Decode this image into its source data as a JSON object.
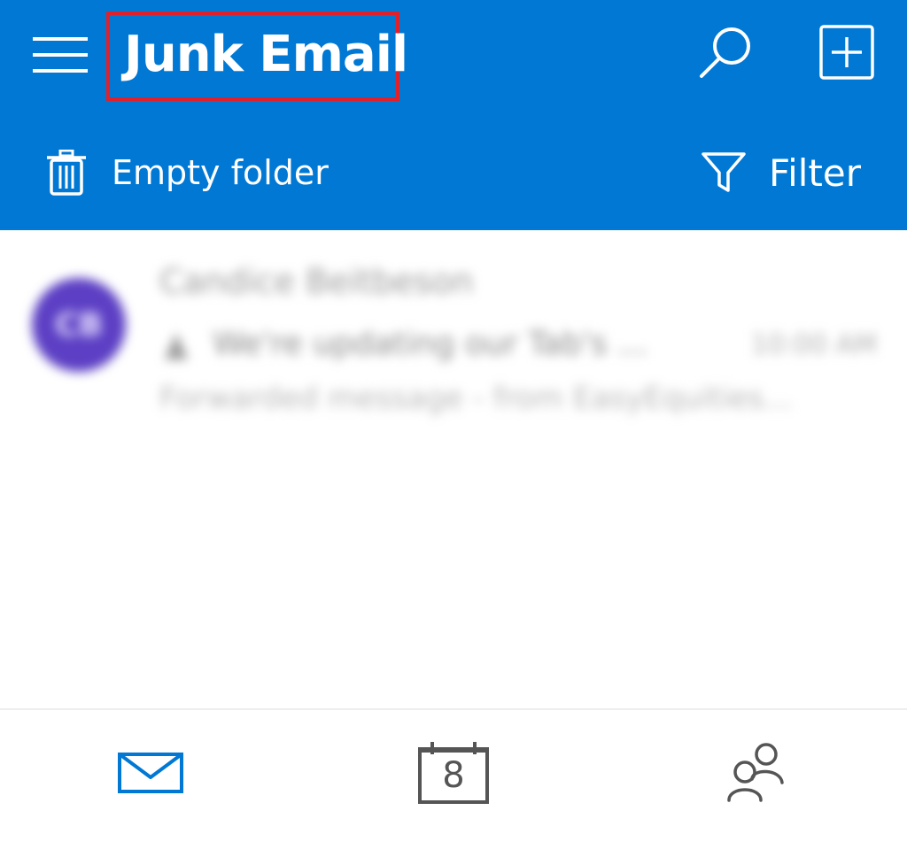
{
  "header": {
    "title": "Junk Email",
    "highlight_color": "#e0202b",
    "background_color": "#0078d4"
  },
  "toolbar": {
    "empty_folder_label": "Empty folder",
    "filter_label": "Filter"
  },
  "messages": [
    {
      "avatar_initials": "CB",
      "sender": "Candice Beitbeson",
      "subject": "We're updating our Tab's ...",
      "time": "10:00 AM",
      "preview": "Forwarded message - from EasyEquities..."
    }
  ],
  "bottom_nav": {
    "calendar_date": "8",
    "active_item": "mail",
    "active_color": "#0078d4"
  }
}
